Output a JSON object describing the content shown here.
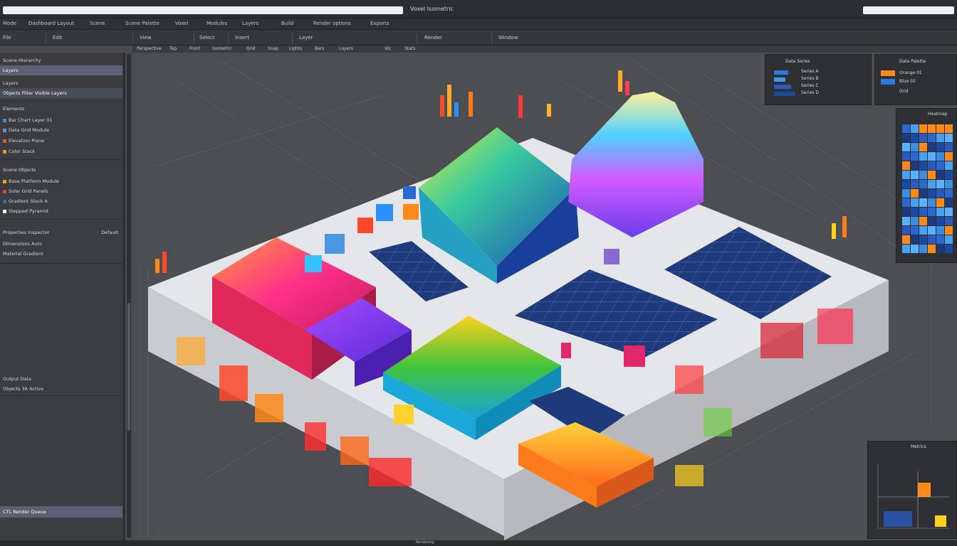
{
  "window": {
    "url_left": "",
    "title": "Voxel Isometric",
    "url_right": ""
  },
  "menu": {
    "items": [
      "Mode",
      "Dashboard Layout",
      "Scene",
      "Scene Palette",
      "Voxel",
      "Modules",
      "Layers",
      "Build",
      "Render options",
      "Exports"
    ]
  },
  "toolbar": {
    "items": [
      "File",
      "Edit",
      "View",
      "Select",
      "Insert",
      "Layer",
      "Render",
      "Window"
    ]
  },
  "subbar": {
    "items": [
      "Perspective",
      "Top",
      "Front",
      "Isometric",
      "Grid",
      "Snap",
      "Lights",
      "Bars",
      "Layers",
      "Viz",
      "Stats"
    ]
  },
  "sidebar": {
    "header": "Scene Hierarchy",
    "selected": "Layers",
    "section_label": "Layers",
    "filter_row": "Objects Filter Visible Layers",
    "group1_label": "Elements",
    "group1": [
      "Bar Chart Layer 01",
      "Data Grid Module",
      "Elevation Plane",
      "Color Stack"
    ],
    "group1_colors": [
      "#3a8de0",
      "#6b88c9",
      "#e6552b",
      "#e89a2a"
    ],
    "group2_label": "Scene Objects",
    "group2": [
      "Base Platform Module",
      "Solar Grid Panels",
      "Gradient Stack A",
      "Stepped Pyramid"
    ],
    "group2_colors": [
      "#f0a020",
      "#d94040",
      "#3070c0",
      "#ffffff"
    ],
    "props_label": "Properties Inspector",
    "props_value": "Default",
    "props_row": "Dimensions Auto",
    "props_row2": "Material Gradient",
    "footer_label": "Output Data",
    "footer_row": "Objects 38 Active",
    "bottom_item": "CTL Render Queue"
  },
  "panels": {
    "panel1_title": "Data Series",
    "panel1_rows": [
      "Series A",
      "Series B",
      "Series C",
      "Series D"
    ],
    "panel2_title": "Data Palette",
    "panel2_rows": [
      "Orange 01",
      "Blue 02",
      "Grid"
    ],
    "heatmap_title": "Heatmap",
    "chart_title": "Metrics"
  },
  "status": {
    "text": "Rendering"
  },
  "colors": {
    "accent": "#5b6072",
    "bg": "#4d4e51",
    "navy": "#1f3a7a"
  }
}
